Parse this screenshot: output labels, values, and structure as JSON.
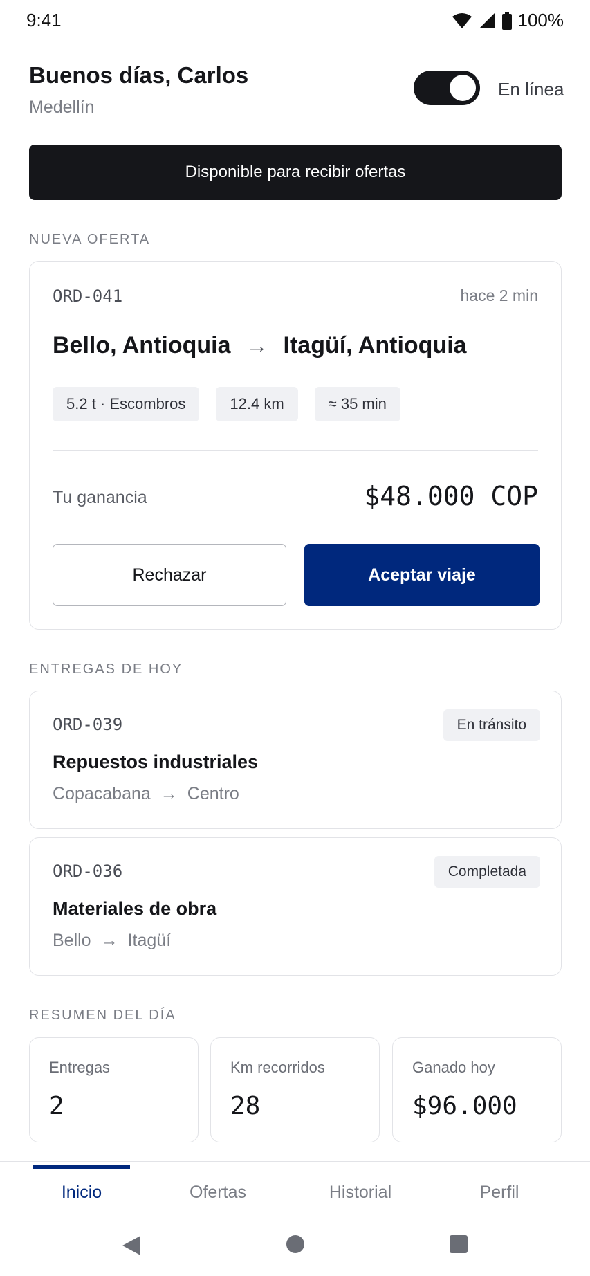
{
  "status_bar": {
    "time": "9:41",
    "battery": "100%"
  },
  "header": {
    "greeting": "Buenos días, Carlos",
    "city": "Medellín",
    "online_label": "En línea",
    "online": true
  },
  "banner": {
    "text": "Disponible para recibir ofertas"
  },
  "offer_section": {
    "label": "NUEVA OFERTA",
    "id": "ORD-041",
    "time": "hace 2 min",
    "origin": "Bello, Antioquia",
    "destination": "Itagüí, Antioquia",
    "chips": [
      "5.2 t · Escombros",
      "12.4 km",
      "≈ 35 min"
    ],
    "earn_label": "Tu ganancia",
    "earn_value": "$48.000 COP",
    "reject_label": "Rechazar",
    "accept_label": "Aceptar viaje"
  },
  "deliveries_section": {
    "label": "ENTREGAS DE HOY",
    "items": [
      {
        "id": "ORD-039",
        "status": "En tránsito",
        "title": "Repuestos industriales",
        "from": "Copacabana",
        "to": "Centro"
      },
      {
        "id": "ORD-036",
        "status": "Completada",
        "title": "Materiales de obra",
        "from": "Bello",
        "to": "Itagüí"
      }
    ]
  },
  "summary_section": {
    "label": "RESUMEN DEL DÍA",
    "stats": [
      {
        "label": "Entregas",
        "value": "2"
      },
      {
        "label": "Km recorridos",
        "value": "28"
      },
      {
        "label": "Ganado hoy",
        "value": "$96.000"
      }
    ]
  },
  "bottom_nav": {
    "items": [
      {
        "label": "Inicio",
        "active": true
      },
      {
        "label": "Ofertas",
        "active": false
      },
      {
        "label": "Historial",
        "active": false
      },
      {
        "label": "Perfil",
        "active": false
      }
    ]
  },
  "colors": {
    "accent": "#00287d",
    "dark": "#15161a",
    "muted": "#7a7d85",
    "chip_bg": "#f0f1f4",
    "border": "#e2e3e7"
  },
  "icons": [
    "wifi-icon",
    "signal-icon",
    "battery-icon",
    "arrow-right-icon",
    "back-icon",
    "home-icon",
    "recents-icon"
  ]
}
